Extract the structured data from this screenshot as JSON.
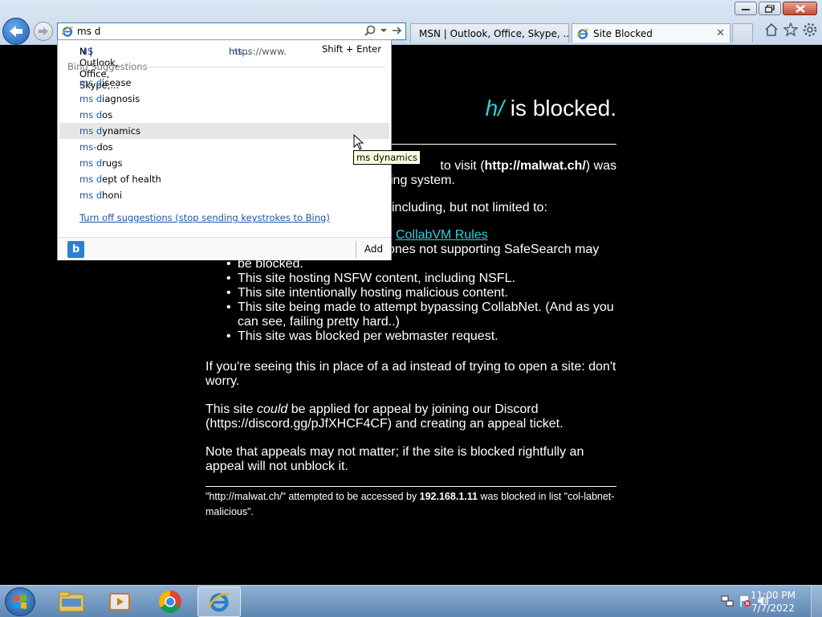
{
  "browser": {
    "address_value": "ms d",
    "tabs": [
      {
        "label": "MSN | Outlook, Office, Skype, ..."
      },
      {
        "label": "Site Blocked"
      }
    ]
  },
  "page": {
    "heading_url_fragment": "h/",
    "heading_rest": " is blocked.",
    "visit_text_start": "to visit (",
    "visit_url": "http://malwat.ch/",
    "visit_text_end": ") was",
    "visit_line2": "ing system.",
    "including": "including, but not limited to:",
    "rules_link": "CollabVM Rules",
    "safesearch_line": "ones not supporting SafeSearch may",
    "be_blocked": "be blocked.",
    "bullets": [
      "This site hosting NSFW content, including NSFL.",
      "This site intentionally hosting malicious content.",
      "This site being made to attempt bypassing CollabNet. (And as you can see, failing pretty hard..)",
      "This site was blocked per webmaster request."
    ],
    "ad_paragraph": "If you're seeing this in place of a ad instead of trying to open a site: don't worry.",
    "appeal_start": "This site ",
    "appeal_em": "could",
    "appeal_end": " be applied for appeal by joining our Discord (https://discord.gg/pJfXHCF4CF) and creating an appeal ticket.",
    "note_paragraph": "Note that appeals may not matter; if the site is blocked rightfully an appeal will not unblock it.",
    "footer_url": "\"http://malwat.ch/\" attempted to be accessed by ",
    "footer_ip": "192.168.1.11",
    "footer_end": " was blocked in list \"col-labnet-malicious\"."
  },
  "suggestions": {
    "top": {
      "prefix": "MS",
      "rest": "N | Outlook, Office, Skype,...",
      "url_prefix": "https://www.",
      "url_hl": "ms...",
      "shortcut": "Shift + Enter"
    },
    "section_label": "Bing Suggestions",
    "items": [
      {
        "typed": "ms d",
        "rest": "isease"
      },
      {
        "typed": "ms d",
        "rest": "iagnosis"
      },
      {
        "typed": "ms d",
        "rest": "os"
      },
      {
        "typed": "ms d",
        "rest": "ynamics"
      },
      {
        "typed": "ms-",
        "rest": "dos"
      },
      {
        "typed": "ms d",
        "rest": "rugs"
      },
      {
        "typed": "ms d",
        "rest": "ept of health"
      },
      {
        "typed": "ms d",
        "rest": "honi"
      }
    ],
    "turn_off": "Turn off suggestions (stop sending keystrokes to Bing)",
    "add_label": "Add",
    "bing_glyph": "b"
  },
  "tooltip": "ms dynamics",
  "taskbar": {
    "time": "11:00 PM",
    "date": "7/7/2022"
  },
  "colors": {
    "link": "#2ed0e0",
    "suggest_highlight": "#1a55a8"
  }
}
